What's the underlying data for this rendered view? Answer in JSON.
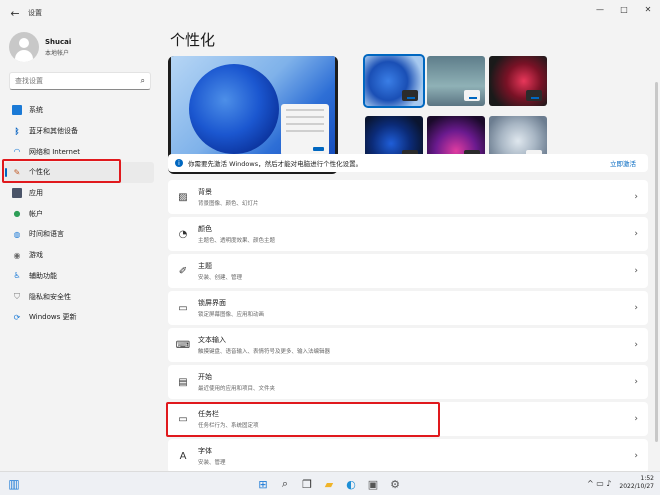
{
  "window": {
    "title": "设置"
  },
  "window_controls": [
    "minimize",
    "maximize",
    "close"
  ],
  "profile": {
    "name": "Shucai",
    "account_type": "本地帐户"
  },
  "search": {
    "placeholder": "查找设置",
    "value": "查找设置"
  },
  "nav": [
    {
      "label": "系统",
      "icon": "system-icon"
    },
    {
      "label": "蓝牙和其他设备",
      "icon": "bluetooth-icon"
    },
    {
      "label": "网络和 Internet",
      "icon": "wifi-icon"
    },
    {
      "label": "个性化",
      "icon": "brush-icon",
      "active": true
    },
    {
      "label": "应用",
      "icon": "apps-icon"
    },
    {
      "label": "帐户",
      "icon": "account-icon"
    },
    {
      "label": "时间和语言",
      "icon": "globe-clock-icon"
    },
    {
      "label": "游戏",
      "icon": "game-icon"
    },
    {
      "label": "辅助功能",
      "icon": "accessibility-icon"
    },
    {
      "label": "隐私和安全性",
      "icon": "shield-icon"
    },
    {
      "label": "Windows 更新",
      "icon": "update-icon"
    }
  ],
  "main": {
    "title": "个性化",
    "notice": {
      "message": "你需要先激活 Windows，然后才能对电脑进行个性化设置。",
      "link": "立即激活"
    },
    "cards": [
      {
        "title": "背景",
        "subtitle": "背景图像、颜色、幻灯片",
        "icon": "image-icon"
      },
      {
        "title": "颜色",
        "subtitle": "主题色、透明度效果、颜色主题",
        "icon": "palette-icon"
      },
      {
        "title": "主题",
        "subtitle": "安装、创建、管理",
        "icon": "pen-icon"
      },
      {
        "title": "锁屏界面",
        "subtitle": "锁定屏幕图像、应用和动画",
        "icon": "lock-screen-icon"
      },
      {
        "title": "文本输入",
        "subtitle": "触摸键盘、语音输入、表情符号及更多、输入法编辑器",
        "icon": "keyboard-icon"
      },
      {
        "title": "开始",
        "subtitle": "最近使用的应用和项目、文件夹",
        "icon": "start-icon"
      },
      {
        "title": "任务栏",
        "subtitle": "任务栏行为、系统固定项",
        "icon": "taskbar-icon"
      },
      {
        "title": "字体",
        "subtitle": "安装、管理",
        "icon": "font-icon"
      }
    ]
  },
  "taskbar": {
    "icons": [
      "start-icon",
      "search-icon",
      "task-view-icon",
      "file-explorer-icon",
      "edge-icon",
      "store-icon",
      "settings-icon"
    ],
    "time": "1:52",
    "date": "2022/10/27"
  },
  "colors": {
    "accent": "#0067c0",
    "highlight_box": "#e0191d"
  }
}
